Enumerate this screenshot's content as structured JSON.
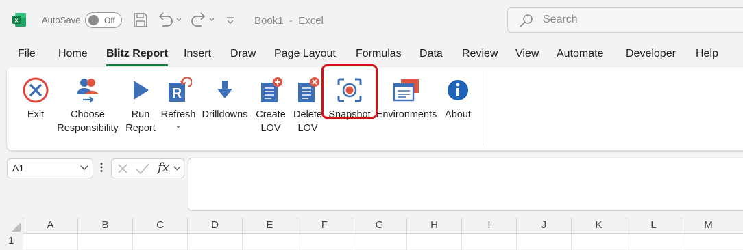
{
  "titlebar": {
    "autosave_label": "AutoSave",
    "autosave_state": "Off",
    "document_title": "Book1  -  Excel",
    "search_placeholder": "Search"
  },
  "tabs": [
    "File",
    "Home",
    "Blitz Report",
    "Insert",
    "Draw",
    "Page Layout",
    "Formulas",
    "Data",
    "Review",
    "View",
    "Automate",
    "Developer",
    "Help"
  ],
  "active_tab": "Blitz Report",
  "ribbon": {
    "buttons": [
      {
        "label": "Exit",
        "icon": "exit-icon"
      },
      {
        "label": "Choose Responsibility",
        "line1": "Choose",
        "line2": "Responsibility",
        "icon": "choose-responsibility-icon"
      },
      {
        "label": "Run Report",
        "line1": "Run",
        "line2": "Report",
        "icon": "run-report-icon"
      },
      {
        "label": "Refresh",
        "icon": "refresh-icon",
        "caret": "⌄"
      },
      {
        "label": "Drilldowns",
        "icon": "drilldowns-icon"
      },
      {
        "label": "Create LOV",
        "line1": "Create",
        "line2": "LOV",
        "icon": "create-lov-icon"
      },
      {
        "label": "Delete LOV",
        "line1": "Delete",
        "line2": "LOV",
        "icon": "delete-lov-icon"
      },
      {
        "label": "Snapshot",
        "icon": "snapshot-icon",
        "highlighted": true
      },
      {
        "label": "Environments",
        "icon": "environments-icon"
      },
      {
        "label": "About",
        "icon": "about-icon"
      }
    ]
  },
  "formula_bar": {
    "name_box": "A1",
    "fx": "fx",
    "formula": ""
  },
  "grid": {
    "columns": [
      "A",
      "B",
      "C",
      "D",
      "E",
      "F",
      "G",
      "H",
      "I",
      "J",
      "K",
      "L",
      "M"
    ],
    "rows": [
      "1"
    ]
  },
  "colors": {
    "accent": "#107c41",
    "highlight_border": "#d4121c",
    "icon_blue": "#3d6fb6",
    "exit_red": "#e0443a",
    "about_blue": "#1e63b8"
  }
}
